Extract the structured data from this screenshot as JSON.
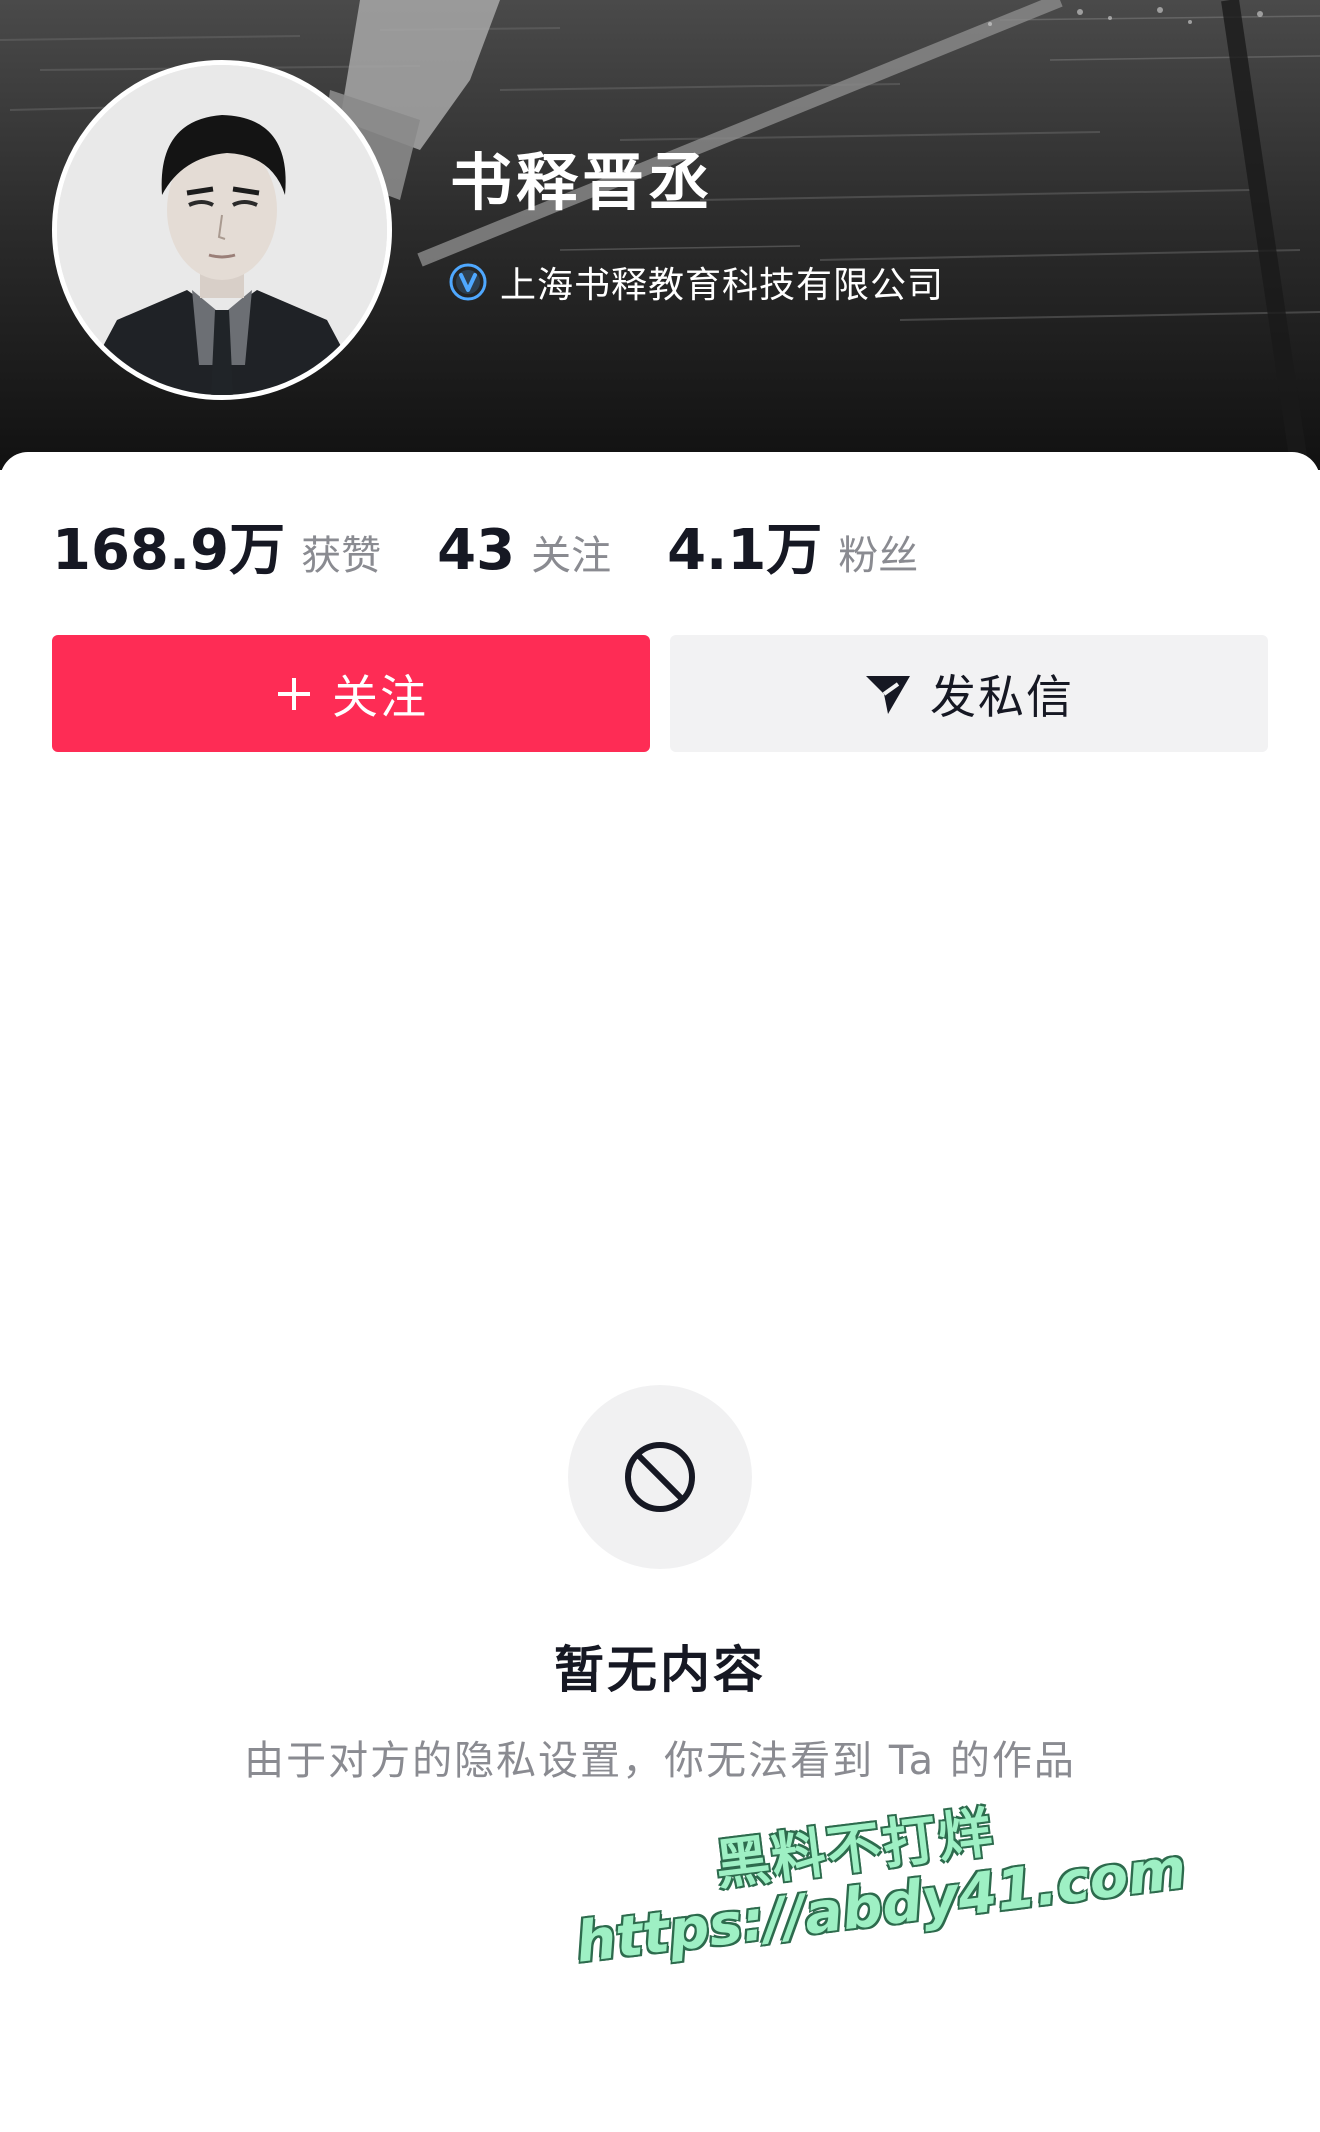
{
  "profile": {
    "username": "书释晋丞",
    "verified_icon": "verified-v-badge-icon",
    "verification": "上海书释教育科技有限公司"
  },
  "stats": [
    {
      "value": "168.9万",
      "label": "获赞"
    },
    {
      "value": "43",
      "label": "关注"
    },
    {
      "value": "4.1万",
      "label": "粉丝"
    }
  ],
  "actions": {
    "follow_label": "关注",
    "follow_icon": "plus-icon",
    "message_label": "发私信",
    "message_icon": "send-arrow-icon"
  },
  "empty_state": {
    "icon": "prohibited-icon",
    "title": "暂无内容",
    "description": "由于对方的隐私设置，你无法看到 Ta 的作品"
  },
  "watermark": {
    "line1": "黑料不打烊",
    "line2": "https://abdy41.com"
  },
  "colors": {
    "follow_button": "#fe2c55",
    "message_button": "#f2f2f3",
    "verified_badge": "#4fa8ff",
    "primary_text": "#161823",
    "secondary_text": "#8a8b91",
    "watermark_fill": "#9ef0c4"
  }
}
